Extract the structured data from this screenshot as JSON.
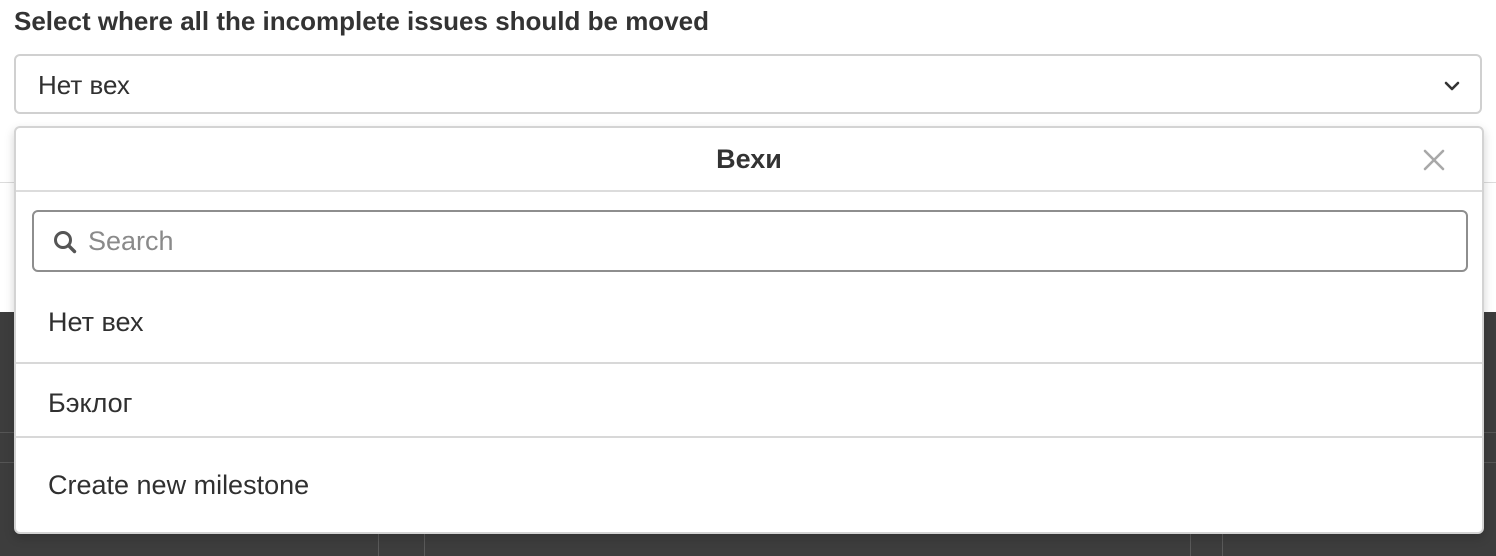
{
  "form": {
    "label": "Select where all the incomplete issues should be moved",
    "selected_value": "Нет вех"
  },
  "dropdown": {
    "title": "Вехи",
    "search_placeholder": "Search",
    "search_value": "",
    "options": [
      {
        "label": "Нет вех"
      },
      {
        "label": "Бэклог"
      },
      {
        "label": "Create new milestone"
      }
    ]
  },
  "icons": {
    "select": "chevron-down-icon",
    "close": "close-icon",
    "search": "search-icon"
  },
  "colors": {
    "text": "#303030",
    "border": "#d0d0d0",
    "search_border": "#8e8e8e",
    "background_overlay": "#3d3d3d"
  }
}
